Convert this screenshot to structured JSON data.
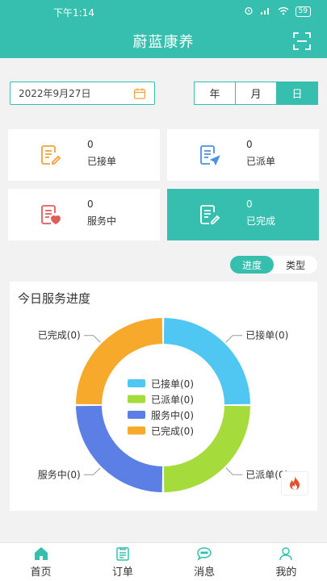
{
  "status_bar": {
    "time": "下午1:14",
    "battery": "59"
  },
  "header": {
    "title": "蔚蓝康养"
  },
  "date_picker": {
    "value": "2022年9月27日"
  },
  "period": {
    "options": [
      "年",
      "月",
      "日"
    ],
    "active": "日"
  },
  "cards": [
    {
      "count": "0",
      "label": "已接单"
    },
    {
      "count": "0",
      "label": "已派单"
    },
    {
      "count": "0",
      "label": "服务中"
    },
    {
      "count": "0",
      "label": "已完成"
    }
  ],
  "view_toggle": {
    "options": [
      "进度",
      "类型"
    ],
    "active": "进度"
  },
  "chart_panel": {
    "title": "今日服务进度"
  },
  "chart_data": {
    "type": "pie",
    "title": "今日服务进度",
    "categories": [
      "已接单",
      "已派单",
      "服务中",
      "已完成"
    ],
    "values": [
      0,
      0,
      0,
      0
    ],
    "callouts": [
      "已接单(0)",
      "已派单(0)",
      "服务中(0)",
      "已完成(0)"
    ],
    "colors": [
      "#4fc7f2",
      "#a5dc3c",
      "#5b7fe5",
      "#f6a92b"
    ],
    "legend_position": "center"
  },
  "tabs": [
    "首页",
    "订单",
    "消息",
    "我的"
  ],
  "colors": {
    "accent": "#36bfaf"
  }
}
